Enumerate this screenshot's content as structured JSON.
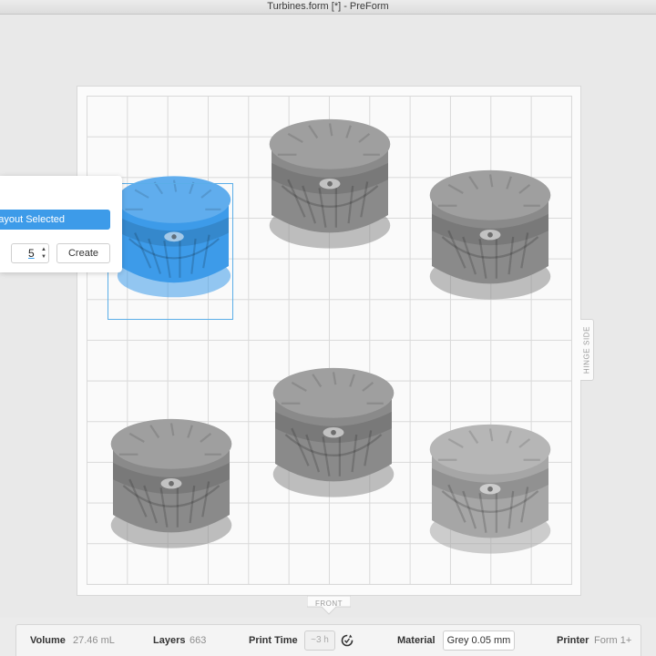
{
  "window": {
    "title": "Turbines.form [*] - PreForm"
  },
  "tray": {
    "front_label": "FRONT",
    "hinge_label": "HINGE SIDE"
  },
  "layout_panel": {
    "layout_button_label": "Layout Selected",
    "copies_value": "5",
    "create_label": "Create"
  },
  "model_colors": {
    "selected": "#3d9be9",
    "unselected": "#8a8a8a"
  },
  "status": {
    "volume_label": "Volume",
    "volume_value": "27.46 mL",
    "layers_label": "Layers",
    "layers_value": "663",
    "print_time_label": "Print Time",
    "print_time_value": "~3 h",
    "material_label": "Material",
    "material_value": "Grey 0.05 mm",
    "printer_label": "Printer",
    "printer_value": "Form 1+"
  }
}
